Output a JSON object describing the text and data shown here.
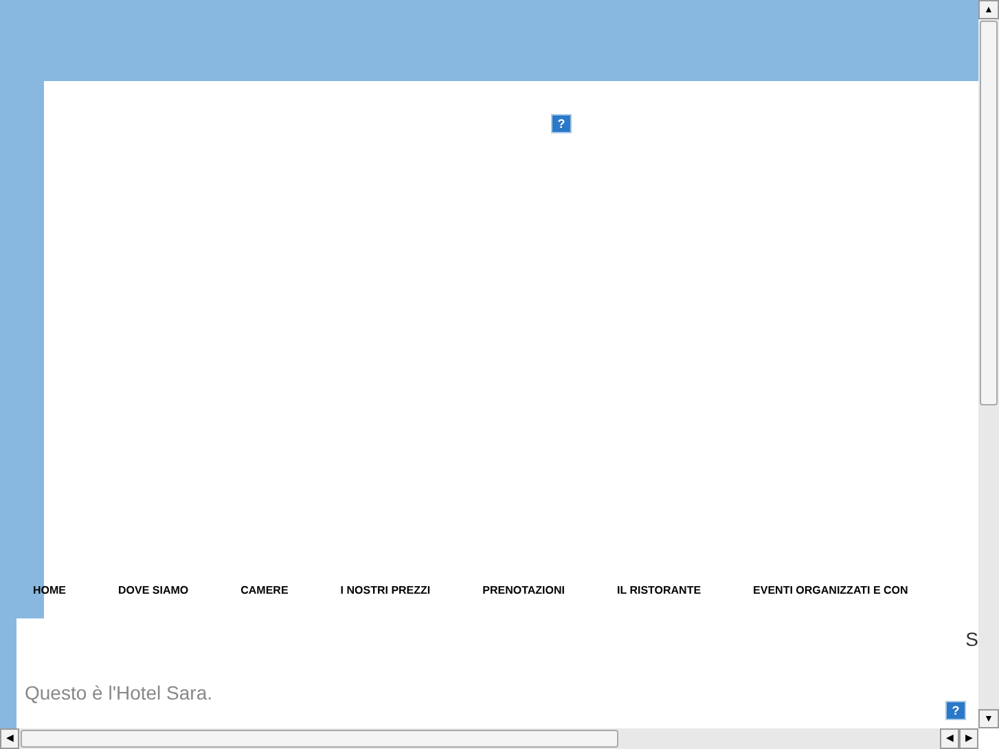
{
  "nav": [
    {
      "label": "HOME"
    },
    {
      "label": "DOVE SIAMO"
    },
    {
      "label": "CAMERE"
    },
    {
      "label": "I NOSTRI PREZZI"
    },
    {
      "label": "PRENOTAZIONI"
    },
    {
      "label": "IL RISTORANTE"
    },
    {
      "label": "EVENTI ORGANIZZATI E CON"
    }
  ],
  "side_letter": "S",
  "intro": "Questo è l'Hotel Sara.",
  "images": [
    {
      "alt": "?"
    },
    {
      "alt": "?"
    }
  ],
  "scrollbars": {
    "up": "▲",
    "down": "▼",
    "left": "◀",
    "right": "▶"
  }
}
